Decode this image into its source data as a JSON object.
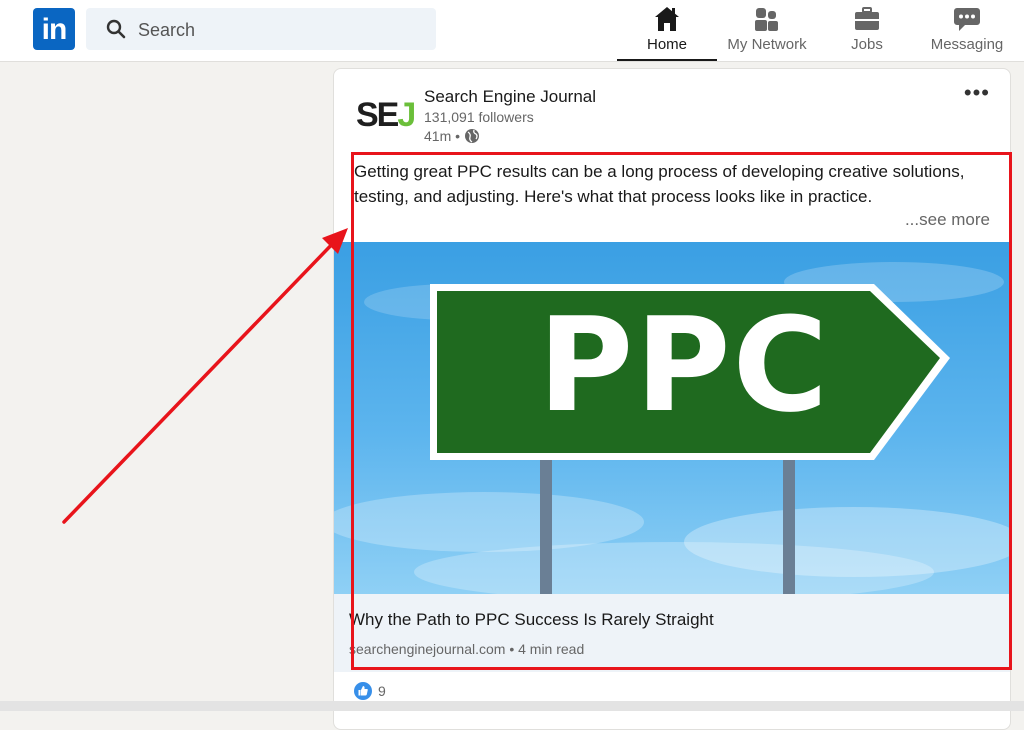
{
  "nav": {
    "logo_text": "in",
    "search_placeholder": "Search",
    "items": [
      {
        "label": "Home",
        "icon": "home-icon",
        "active": true
      },
      {
        "label": "My Network",
        "icon": "network-icon",
        "active": false
      },
      {
        "label": "Jobs",
        "icon": "briefcase-icon",
        "active": false
      },
      {
        "label": "Messaging",
        "icon": "chat-icon",
        "active": false
      }
    ]
  },
  "post": {
    "author_logo": {
      "left": "SE",
      "right": "J"
    },
    "author_name": "Search Engine Journal",
    "followers": "131,091 followers",
    "time": "41m •",
    "text": "Getting great PPC results can be a long process of developing creative solutions, testing, and adjusting. Here's what that process looks like in practice.",
    "see_more": "...see more",
    "image_sign_text": "PPC",
    "link_title": "Why the Path to PPC Success Is Rarely Straight",
    "link_source": "searchenginejournal.com • 4 min read",
    "reaction_count": "9"
  },
  "colors": {
    "brand": "#0a66c2",
    "annotation": "#e8141b",
    "sign_green": "#1f6a1f",
    "sej_green": "#6bbf3a"
  }
}
